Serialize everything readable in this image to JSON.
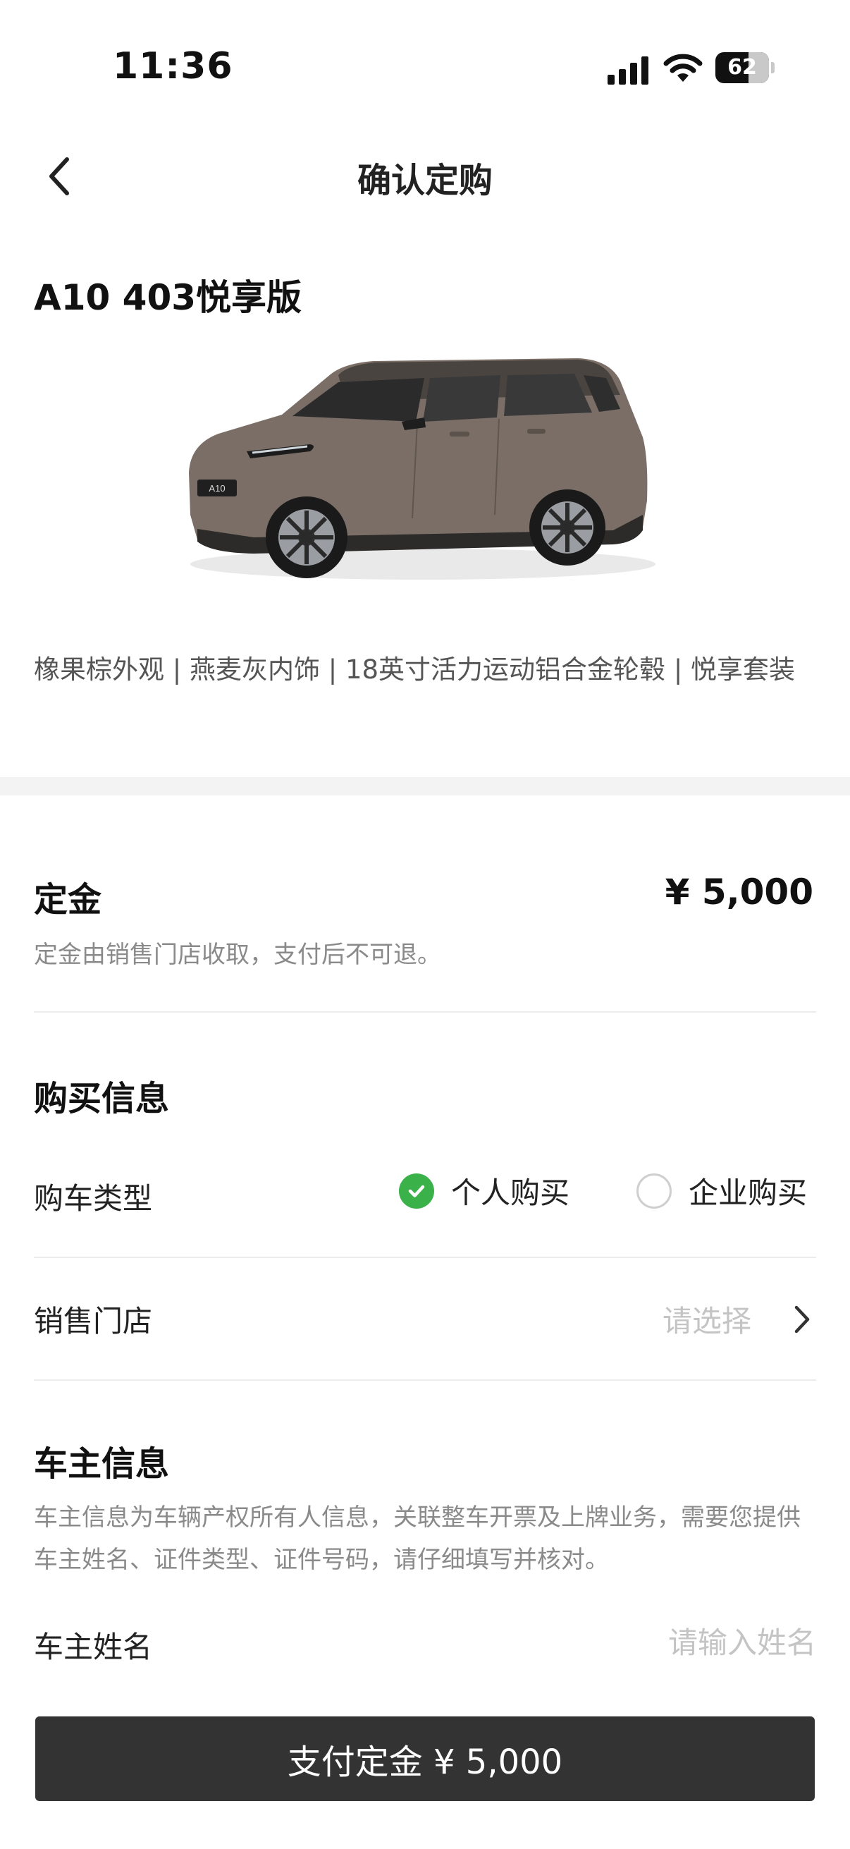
{
  "status_bar": {
    "time": "11:36",
    "battery_level": "62",
    "battery_fraction": 0.62,
    "icons": [
      "signal-icon",
      "wifi-icon",
      "battery-icon"
    ]
  },
  "nav": {
    "title": "确认定购",
    "back_icon": "chevron-left-icon"
  },
  "product": {
    "model_name": "A10 403悦享版",
    "image_icon": "car-image",
    "config": "橡果棕外观 | 燕麦灰内饰 | 18英寸活力运动铝合金轮毂 | 悦享套装"
  },
  "deposit": {
    "title": "定金",
    "amount": "¥ 5,000",
    "note": "定金由销售门店收取，支付后不可退。"
  },
  "purchase_info": {
    "title": "购买信息",
    "buy_type_label": "购车类型",
    "options": [
      {
        "label": "个人购买",
        "selected": true
      },
      {
        "label": "企业购买",
        "selected": false
      }
    ],
    "store_label": "销售门店",
    "store_placeholder": "请选择"
  },
  "owner_info": {
    "title": "车主信息",
    "note": "车主信息为车辆产权所有人信息，关联整车开票及上牌业务，需要您提供车主姓名、证件类型、证件号码，请仔细填写并核对。",
    "name_label": "车主姓名",
    "name_placeholder": "请输入姓名",
    "name_value": ""
  },
  "footer": {
    "pay_button": "支付定金 ¥ 5,000"
  },
  "colors": {
    "accent_green": "#3bb14a",
    "button_dark": "#333333",
    "muted_text": "#8a8a8a",
    "placeholder": "#c4c4c4"
  }
}
